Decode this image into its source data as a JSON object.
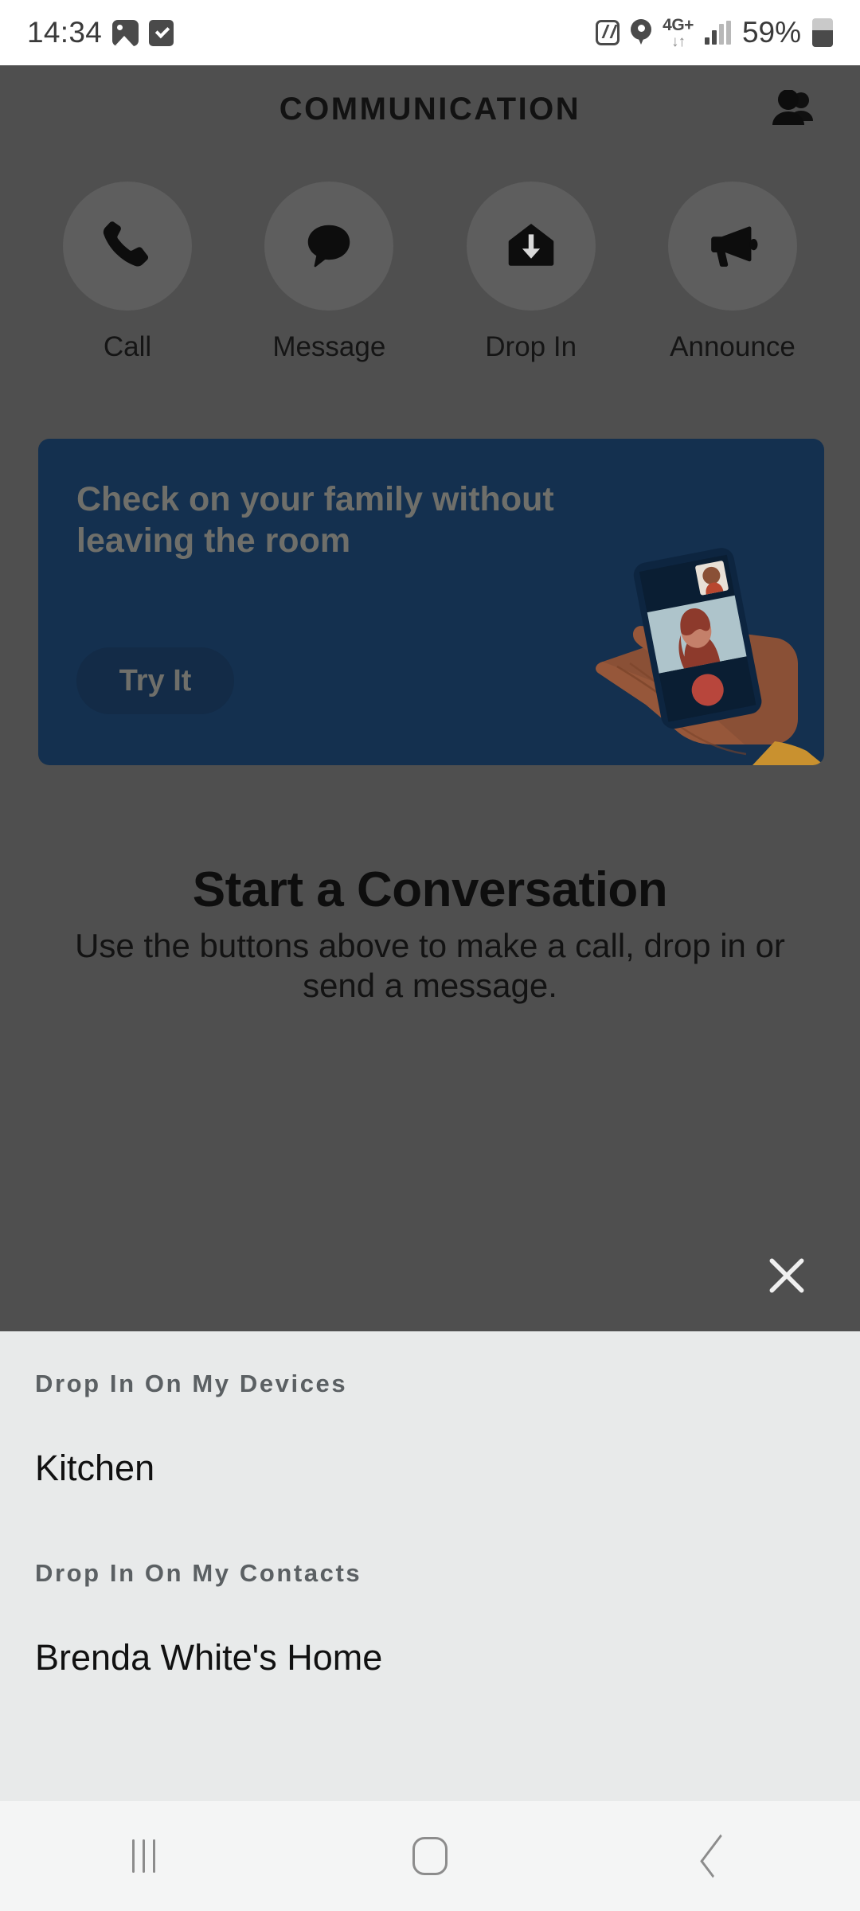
{
  "status_bar": {
    "time": "14:34",
    "left_icons": [
      "photo-icon",
      "checkbox-icon"
    ],
    "right_icons": [
      "nfc-icon",
      "location-pin-icon",
      "signal-bars-icon",
      "battery-icon"
    ],
    "network_label": "4G+",
    "network_arrows": "↓↑",
    "battery_percent": "59%"
  },
  "header": {
    "title": "COMMUNICATION",
    "contacts_icon": "people-icon"
  },
  "actions": [
    {
      "label": "Call",
      "icon": "phone-icon"
    },
    {
      "label": "Message",
      "icon": "speech-bubble-icon"
    },
    {
      "label": "Drop In",
      "icon": "house-arrow-down-icon"
    },
    {
      "label": "Announce",
      "icon": "megaphone-icon"
    }
  ],
  "banner": {
    "headline": "Check on your family without leaving the room",
    "button_label": "Try It",
    "art": "hand-holding-phone-video-call-illustration",
    "background_color": "#14304f",
    "button_color": "#132b47",
    "text_color": "#6f6f6a"
  },
  "empty_state": {
    "title": "Start a Conversation",
    "subtitle": "Use the buttons above to make a call, drop in or send a message."
  },
  "overlay": {
    "close_icon": "close-x-icon",
    "scrim_color": "#4f4f4f"
  },
  "sheet": {
    "background_color": "#e8eaea",
    "sections": [
      {
        "header": "Drop In On My Devices",
        "items": [
          "Kitchen"
        ]
      },
      {
        "header": "Drop In On My Contacts",
        "items": [
          "Brenda White's Home"
        ]
      }
    ]
  },
  "navbar": {
    "buttons": [
      {
        "name": "recents",
        "icon": "recents-icon"
      },
      {
        "name": "home",
        "icon": "home-icon"
      },
      {
        "name": "back",
        "icon": "back-chevron-icon"
      }
    ]
  }
}
